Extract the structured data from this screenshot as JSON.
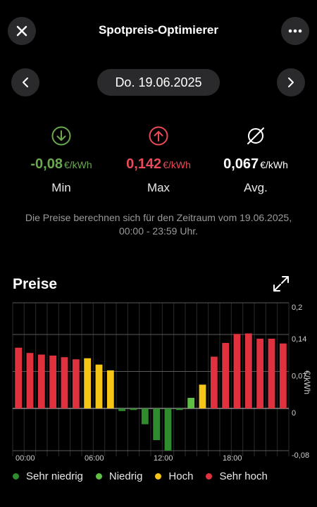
{
  "header": {
    "title": "Spotpreis-Optimierer",
    "close_icon": "close-icon",
    "more_icon": "more-dots-icon"
  },
  "date_nav": {
    "date": "Do. 19.06.2025",
    "prev_icon": "chevron-left-icon",
    "next_icon": "chevron-right-icon"
  },
  "stats": {
    "min": {
      "value": "-0,08",
      "unit": "€/kWh",
      "label": "Min",
      "color": "#6aa84f",
      "icon": "arrow-down-circle-icon"
    },
    "max": {
      "value": "0,142",
      "unit": "€/kWh",
      "label": "Max",
      "color": "#ea4a55",
      "icon": "arrow-up-circle-icon"
    },
    "avg": {
      "value": "0,067",
      "unit": "€/kWh",
      "label": "Avg.",
      "color": "#ffffff",
      "icon": "average-icon"
    }
  },
  "note": "Die Preise berechnen sich für den Zeitraum vom 19.06.2025, 00:00 - 23:59 Uhr.",
  "section_title": "Preise",
  "expand_icon": "expand-icon",
  "colors": {
    "sehr_niedrig": "#2e8b2e",
    "niedrig": "#5fbf45",
    "hoch": "#f5c518",
    "sehr_hoch": "#e0313f"
  },
  "chart_data": {
    "type": "bar",
    "title": "Preise",
    "ylabel": "€/kWh",
    "ylim": [
      -0.08,
      0.2
    ],
    "y_ticks": [
      "0,2",
      "0,14",
      "0,07",
      "0",
      "-0,08"
    ],
    "y_tick_values": [
      0.2,
      0.14,
      0.07,
      0,
      -0.08
    ],
    "x_tick_labels": [
      "00:00",
      "06:00",
      "12:00",
      "18:00"
    ],
    "x_tick_hours": [
      0,
      6,
      12,
      18
    ],
    "categories": [
      "00",
      "01",
      "02",
      "03",
      "04",
      "05",
      "06",
      "07",
      "08",
      "09",
      "10",
      "11",
      "12",
      "13",
      "14",
      "15",
      "16",
      "17",
      "18",
      "19",
      "20",
      "21",
      "22",
      "23"
    ],
    "values": [
      0.115,
      0.105,
      0.102,
      0.1,
      0.097,
      0.093,
      0.095,
      0.083,
      0.072,
      -0.005,
      -0.003,
      -0.03,
      -0.06,
      -0.08,
      -0.003,
      0.02,
      0.045,
      0.098,
      0.124,
      0.141,
      0.142,
      0.132,
      0.132,
      0.123
    ],
    "levels": [
      "sehr_hoch",
      "sehr_hoch",
      "sehr_hoch",
      "sehr_hoch",
      "sehr_hoch",
      "sehr_hoch",
      "hoch",
      "hoch",
      "hoch",
      "sehr_niedrig",
      "sehr_niedrig",
      "sehr_niedrig",
      "sehr_niedrig",
      "sehr_niedrig",
      "sehr_niedrig",
      "niedrig",
      "hoch",
      "sehr_hoch",
      "sehr_hoch",
      "sehr_hoch",
      "sehr_hoch",
      "sehr_hoch",
      "sehr_hoch",
      "sehr_hoch"
    ],
    "legend": [
      {
        "key": "sehr_niedrig",
        "label": "Sehr niedrig"
      },
      {
        "key": "niedrig",
        "label": "Niedrig"
      },
      {
        "key": "hoch",
        "label": "Hoch"
      },
      {
        "key": "sehr_hoch",
        "label": "Sehr hoch"
      }
    ]
  }
}
